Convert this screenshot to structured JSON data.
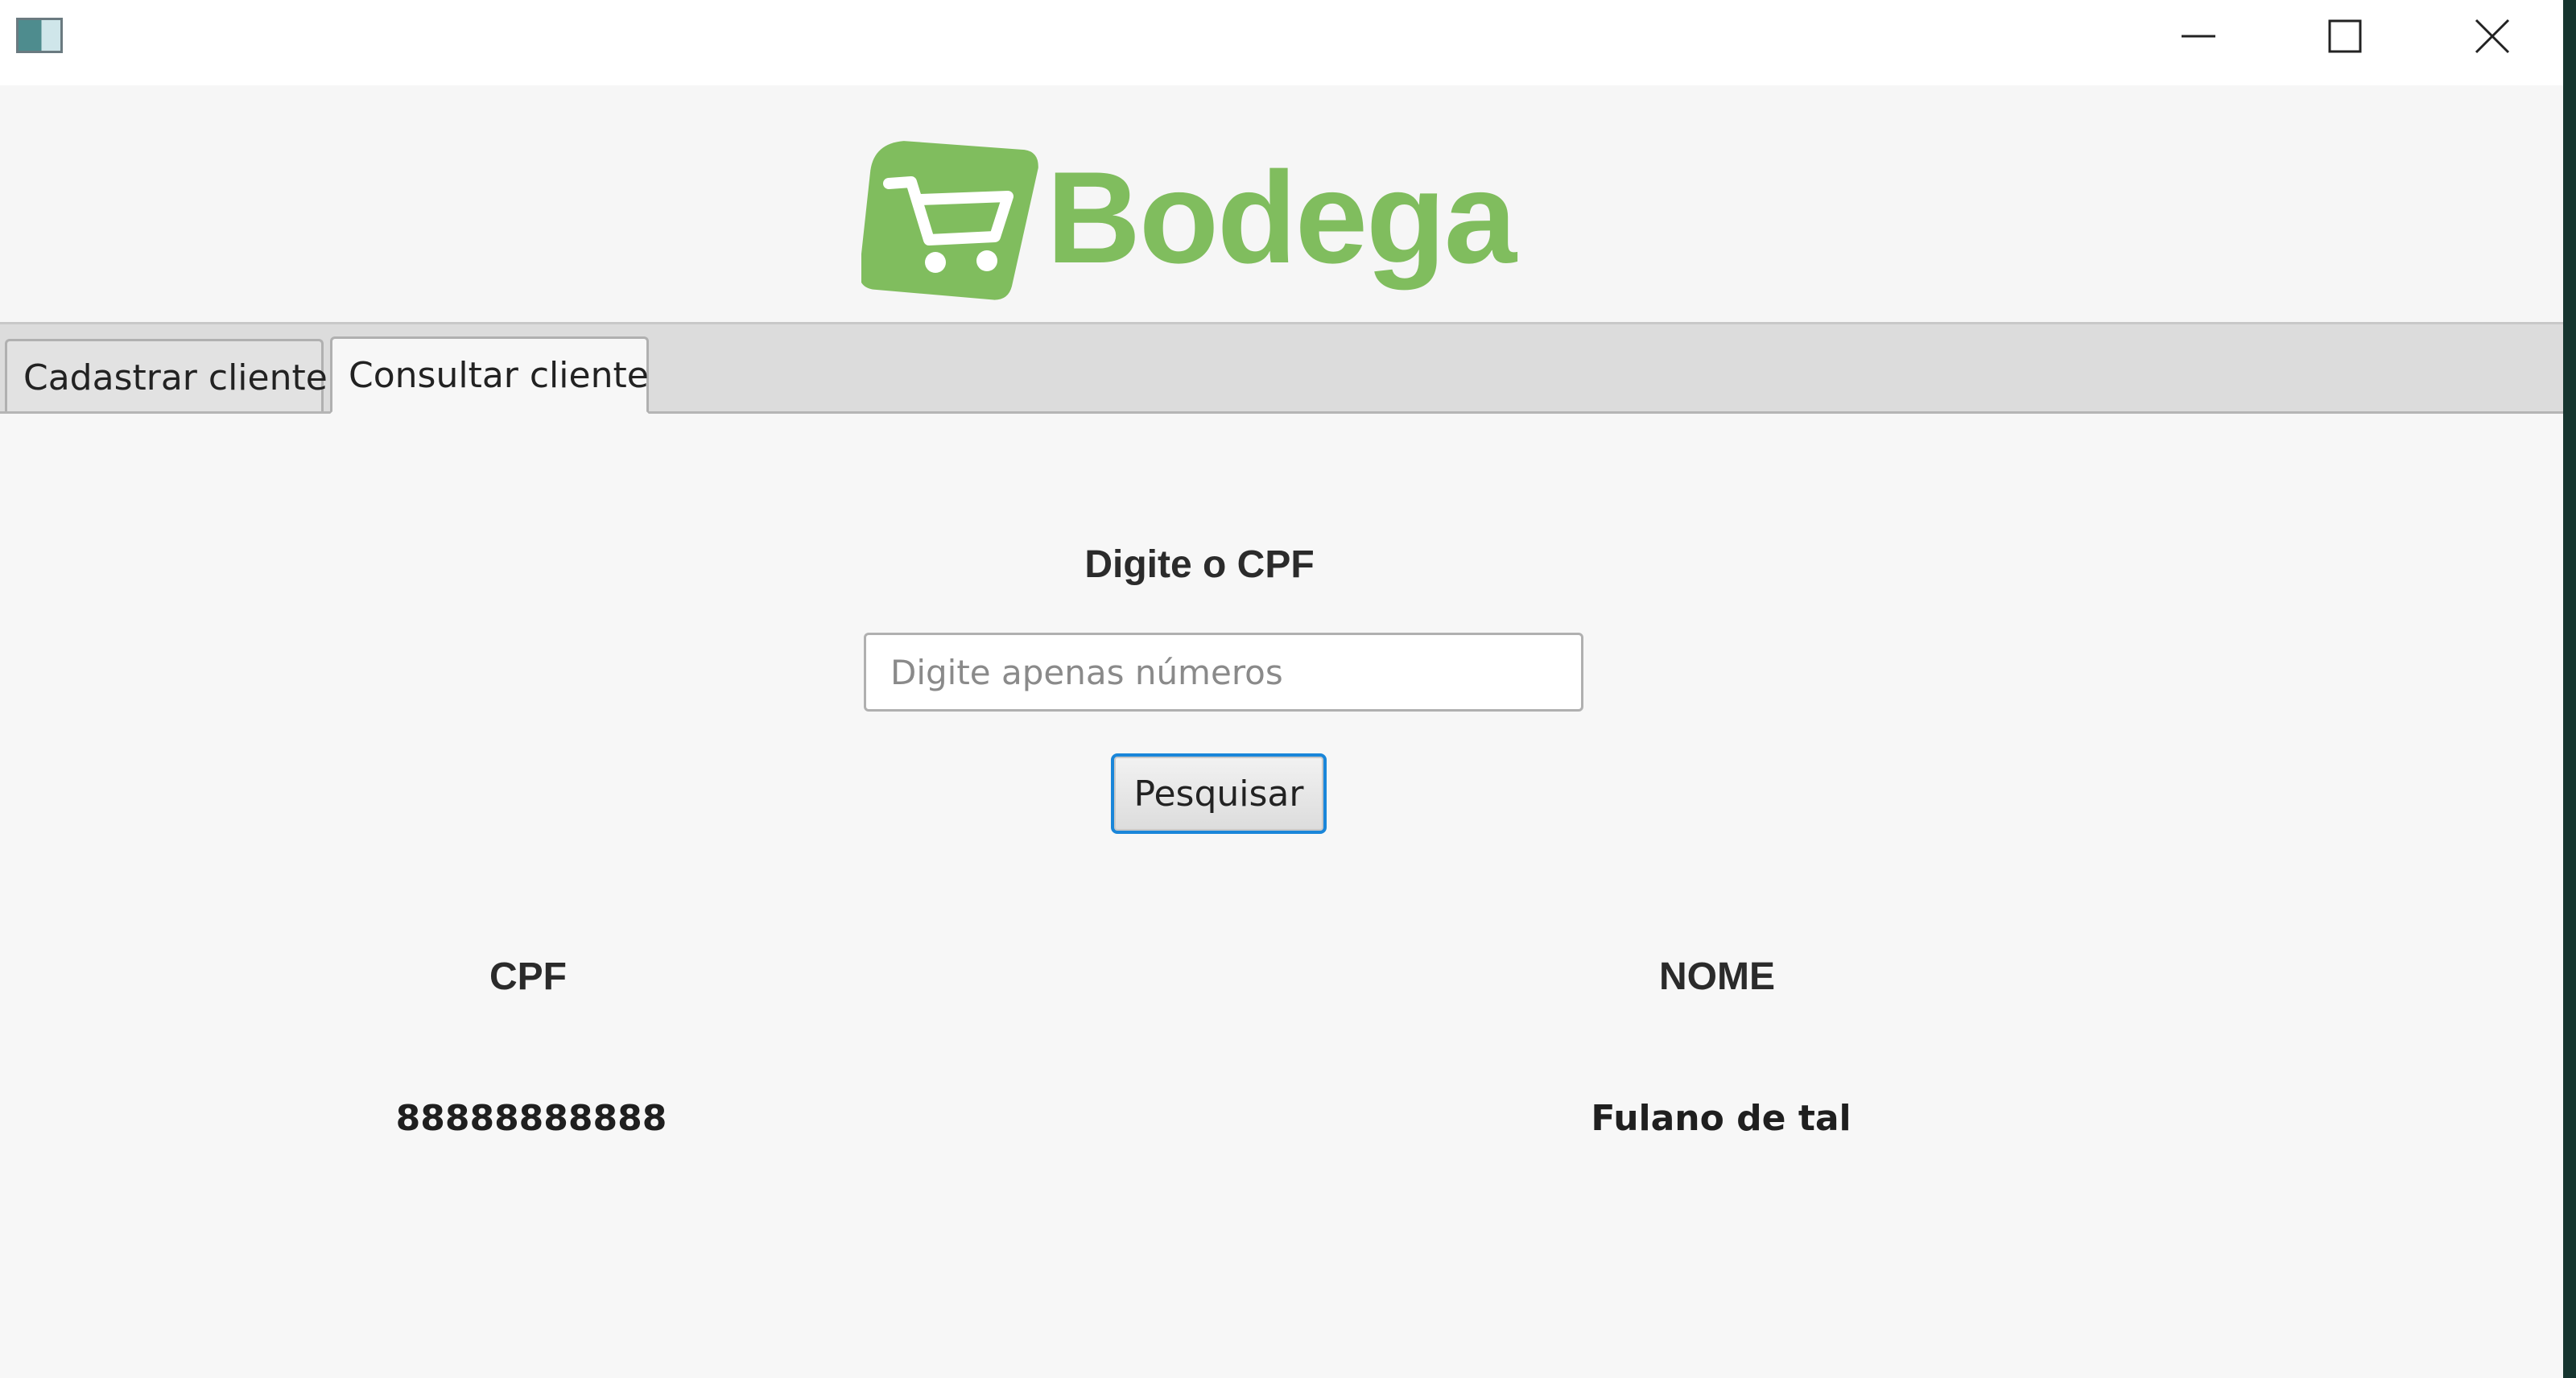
{
  "window": {
    "icon": "app-window-icon",
    "controls": {
      "minimize_icon": "minimize-icon",
      "maximize_icon": "maximize-icon",
      "close_icon": "close-icon"
    }
  },
  "logo": {
    "text": "Bodega",
    "icon": "shopping-cart-icon",
    "color": "#80bd5e"
  },
  "tabs": [
    {
      "label": "Cadastrar cliente",
      "selected": false
    },
    {
      "label": "Consultar cliente",
      "selected": true
    }
  ],
  "search": {
    "prompt": "Digite o CPF",
    "placeholder": "Digite apenas números",
    "value": "",
    "button_label": "Pesquisar"
  },
  "results": {
    "columns": [
      "CPF",
      "NOME"
    ],
    "rows": [
      [
        "88888888888",
        "Fulano de tal"
      ]
    ]
  },
  "colors": {
    "accent": "#1a86d9",
    "background": "#f7f7f7"
  }
}
